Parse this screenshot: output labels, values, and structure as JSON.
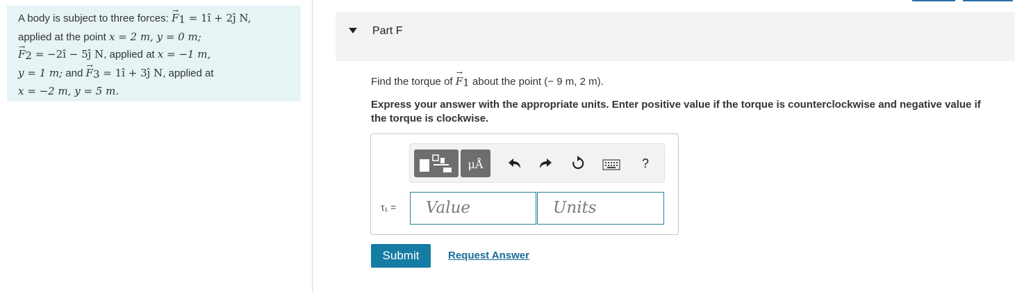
{
  "problem": {
    "line1_pre": "A body is subject to three forces: ",
    "f1_label": "F",
    "f1_eq": " = 1î + 2ĵ N,",
    "line2_pre": "applied at the point ",
    "line2_math": "x = 2 m, y = 0 m;",
    "f2_label": "F",
    "f2_eq": " = −2î − 5ĵ N",
    "line3_mid": ", applied at ",
    "line3_math": "x = −1 m,",
    "line4_math": "y = 1 m;",
    "line4_and": " and ",
    "f3_label": "F",
    "f3_eq": " = 1î + 3ĵ N",
    "line4_end": ", applied at",
    "line5_math": "x = −2 m, y = 5 m."
  },
  "part": {
    "title": "Part F"
  },
  "question": {
    "pre": "Find the torque of ",
    "force": "F",
    "sub": "1",
    "post": " about the point (− 9 m, 2 m)."
  },
  "instruction": "Express your answer with the appropriate units. Enter positive value if the torque is counterclockwise and negative value if the torque is clockwise.",
  "toolbar": {
    "units_button": "μÅ",
    "help": "?"
  },
  "answer": {
    "label": "τ₁ =",
    "value_placeholder": "Value",
    "units_placeholder": "Units"
  },
  "actions": {
    "submit": "Submit",
    "request": "Request Answer"
  }
}
